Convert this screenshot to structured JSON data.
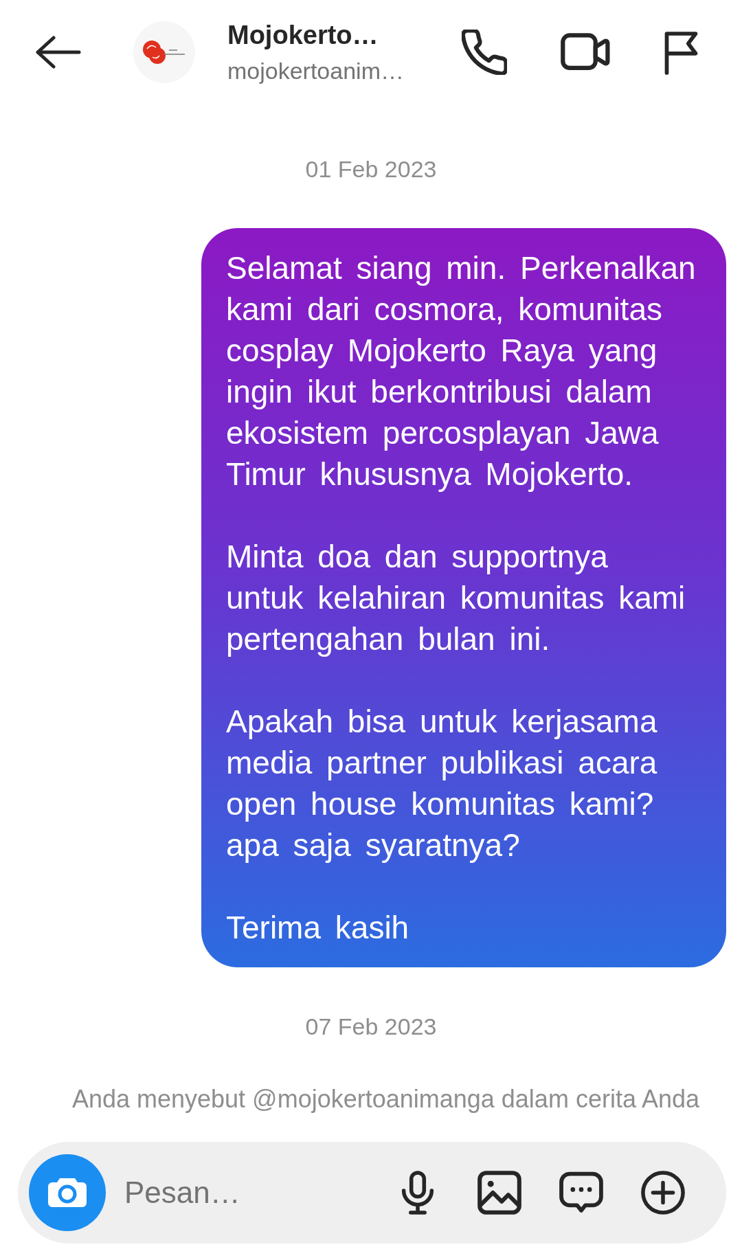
{
  "header": {
    "title": "Mojokerto…",
    "subtitle": "mojokertoanim…"
  },
  "thread": [
    {
      "kind": "date",
      "text": "01 Feb 2023"
    },
    {
      "kind": "message",
      "outgoing": true,
      "paragraphs": [
        "Selamat siang min. Perkenalkan kami dari cosmora, komunitas cosplay Mojokerto Raya yang ingin ikut berkontribusi dalam ekosistem percosplayan Jawa Timur khususnya Mojokerto.",
        "Minta doa dan supportnya untuk kelahiran komunitas kami pertengahan bulan ini.",
        "Apakah bisa untuk kerjasama media partner publikasi acara open house komunitas kami? apa saja syaratnya?",
        "Terima kasih"
      ]
    },
    {
      "kind": "date",
      "text": "07 Feb 2023"
    },
    {
      "kind": "notice",
      "text": "Anda menyebut @mojokertoanimanga dalam cerita Anda"
    }
  ],
  "composer": {
    "placeholder": "Pesan…"
  }
}
